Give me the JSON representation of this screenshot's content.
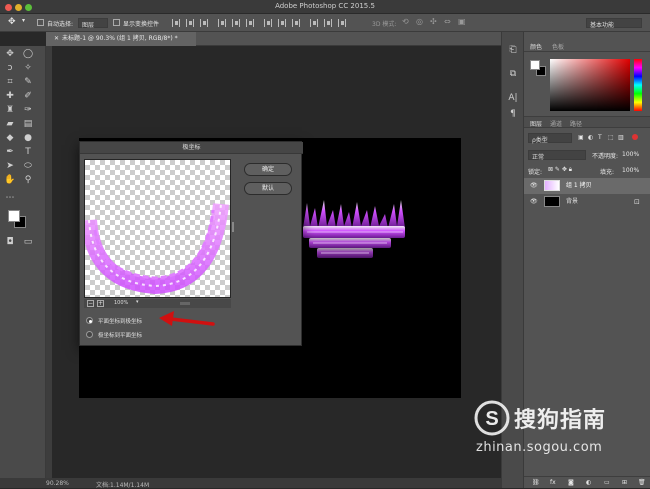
{
  "app": {
    "title": "Adobe Photoshop CC 2015.5"
  },
  "options_bar": {
    "auto_select_label": "自动选择:",
    "auto_select_value": "图层",
    "show_transform_label": "显示变换控件",
    "mode_3d": "3D 模式:",
    "workspace": "基本功能"
  },
  "document": {
    "tab_label": "未标题-1 @ 90.3% (组 1 拷贝, RGB/8*) *"
  },
  "dialog": {
    "title": "极坐标",
    "ok": "确定",
    "default": "默认",
    "zoom_value": "100%",
    "options": [
      {
        "label": "平面坐标到极坐标",
        "selected": true
      },
      {
        "label": "极坐标到平面坐标",
        "selected": false
      }
    ]
  },
  "panels": {
    "color_tabs": [
      "颜色",
      "色板"
    ],
    "layer_tabs": [
      "图层",
      "通道",
      "路径"
    ],
    "filter_type": "ρ类型",
    "blend_mode": "正常",
    "opacity_label": "不透明度:",
    "opacity_value": "100%",
    "lock_label": "锁定:",
    "fill_label": "填充:",
    "fill_value": "100%",
    "layers": [
      {
        "name": "组 1 拷贝",
        "selected": true
      },
      {
        "name": "背景",
        "selected": false
      }
    ]
  },
  "status": {
    "zoom": "90.28%",
    "doc_size": "文档:1.14M/1.14M"
  },
  "watermark": {
    "brand": "搜狗指南",
    "url": "zhinan.sogou.com"
  },
  "colors": {
    "accent_arrow": "#d01010",
    "magenta_glow": "#d050ff"
  }
}
